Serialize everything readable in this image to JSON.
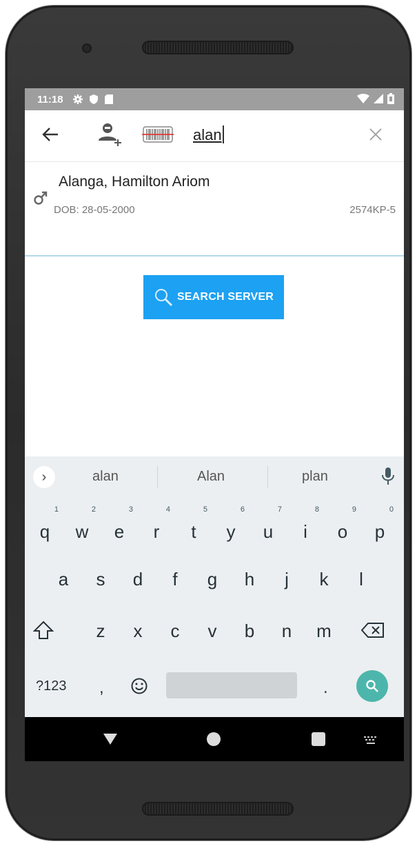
{
  "status_bar": {
    "time": "11:18",
    "icons": [
      "gear-icon",
      "shield-icon",
      "sd-card-icon",
      "wifi-icon",
      "signal-icon",
      "battery-icon"
    ]
  },
  "search": {
    "value": "alan",
    "icons": [
      "back-arrow-icon",
      "add-user-icon",
      "barcode-icon",
      "clear-icon"
    ]
  },
  "result": {
    "name": "Alanga, Hamilton Ariom",
    "dob": "DOB: 28-05-2000",
    "id": "2574KP-5",
    "gender_icon": "male-icon"
  },
  "search_server_label": "SEARCH SERVER",
  "keyboard": {
    "suggestions": [
      "alan",
      "Alan",
      "plan"
    ],
    "row1": [
      "q",
      "w",
      "e",
      "r",
      "t",
      "y",
      "u",
      "i",
      "o",
      "p"
    ],
    "row1_hints": [
      "1",
      "2",
      "3",
      "4",
      "5",
      "6",
      "7",
      "8",
      "9",
      "0"
    ],
    "row2": [
      "a",
      "s",
      "d",
      "f",
      "g",
      "h",
      "j",
      "k",
      "l"
    ],
    "row3": [
      "z",
      "x",
      "c",
      "v",
      "b",
      "n",
      "m"
    ],
    "symbols_key": "?123",
    "comma_key": ",",
    "period_key": "."
  },
  "colors": {
    "accent": "#1da1f2",
    "keyboard_action": "#4db6ac",
    "status_bar": "#9e9e9e"
  }
}
